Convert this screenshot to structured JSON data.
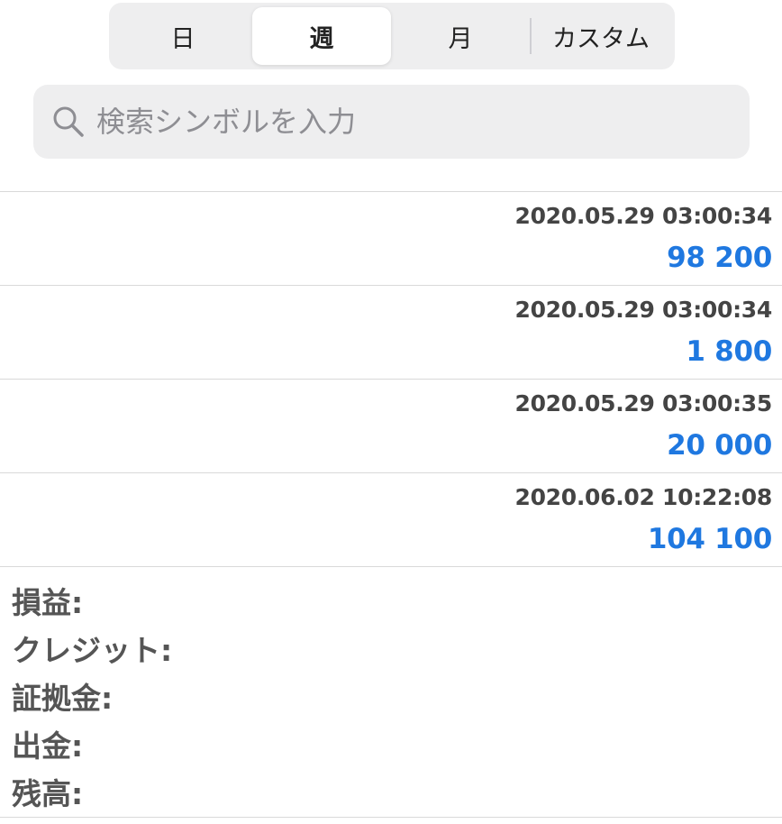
{
  "period_tabs": {
    "items": [
      {
        "label": "日"
      },
      {
        "label": "週"
      },
      {
        "label": "月"
      },
      {
        "label": "カスタム"
      }
    ],
    "selected": "週"
  },
  "search": {
    "placeholder": "検索シンボルを入力",
    "icon": "search-icon"
  },
  "transactions": [
    {
      "timestamp": "2020.05.29 03:00:34",
      "amount": "98 200"
    },
    {
      "timestamp": "2020.05.29 03:00:34",
      "amount": "1 800"
    },
    {
      "timestamp": "2020.05.29 03:00:35",
      "amount": "20 000"
    },
    {
      "timestamp": "2020.06.02 10:22:08",
      "amount": "104 100"
    }
  ],
  "summary": {
    "profit": "損益:",
    "credit": "クレジット:",
    "margin": "証拠金:",
    "withdrawal": "出金:",
    "balance": "残高:"
  },
  "colors": {
    "amount": "#1f78e0",
    "segment_bg": "#eeeeef",
    "text": "#444444"
  }
}
